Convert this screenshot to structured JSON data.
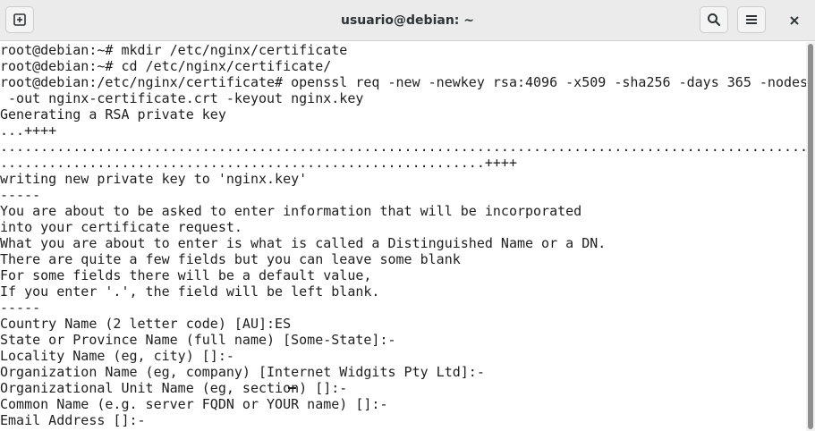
{
  "window": {
    "title": "usuario@debian: ~",
    "buttons": {
      "new_tab_icon": "new-tab-icon",
      "search_icon": "search-icon",
      "menu_icon": "hamburger-menu-icon",
      "close_icon": "close-icon"
    }
  },
  "terminal": {
    "lines": [
      "root@debian:~# mkdir /etc/nginx/certificate",
      "root@debian:~# cd /etc/nginx/certificate/",
      "root@debian:/etc/nginx/certificate# openssl req -new -newkey rsa:4096 -x509 -sha256 -days 365 -nodes",
      " -out nginx-certificate.crt -keyout nginx.key",
      "Generating a RSA private key",
      "...++++",
      "....................................................................................................",
      "............................................................++++",
      "writing new private key to 'nginx.key'",
      "-----",
      "You are about to be asked to enter information that will be incorporated",
      "into your certificate request.",
      "What you are about to enter is what is called a Distinguished Name or a DN.",
      "There are quite a few fields but you can leave some blank",
      "For some fields there will be a default value,",
      "If you enter '.', the field will be left blank.",
      "-----",
      "Country Name (2 letter code) [AU]:ES",
      "State or Province Name (full name) [Some-State]:-",
      "Locality Name (eg, city) []:-",
      "Organization Name (eg, company) [Internet Widgits Pty Ltd]:-",
      "Organizational Unit Name (eg, section) []:-",
      "Common Name (e.g. server FQDN or YOUR name) []:-",
      "Email Address []:-"
    ]
  }
}
